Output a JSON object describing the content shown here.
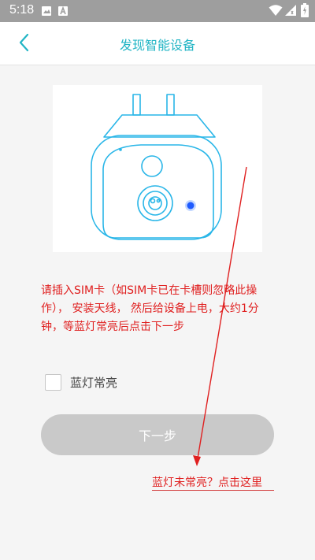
{
  "status_bar": {
    "time": "5:18"
  },
  "app_bar": {
    "title": "发现智能设备"
  },
  "instructions": {
    "text": "请插入SIM卡（如SIM卡已在卡槽则忽略此操作），  安装天线，  然后给设备上电，大约1分钟，等蓝灯常亮后点击下一步"
  },
  "checkbox": {
    "label": "蓝灯常亮",
    "checked": false
  },
  "next_button": {
    "label": "下一步",
    "enabled": false
  },
  "help_link": {
    "text": "蓝灯未常亮？点击这里"
  },
  "colors": {
    "accent": "#22b5c5",
    "annotation_red": "#e02020",
    "disabled_button": "#c9c9c9",
    "status_bar": "#9e9e9e",
    "led_blue": "#1e5bff"
  }
}
